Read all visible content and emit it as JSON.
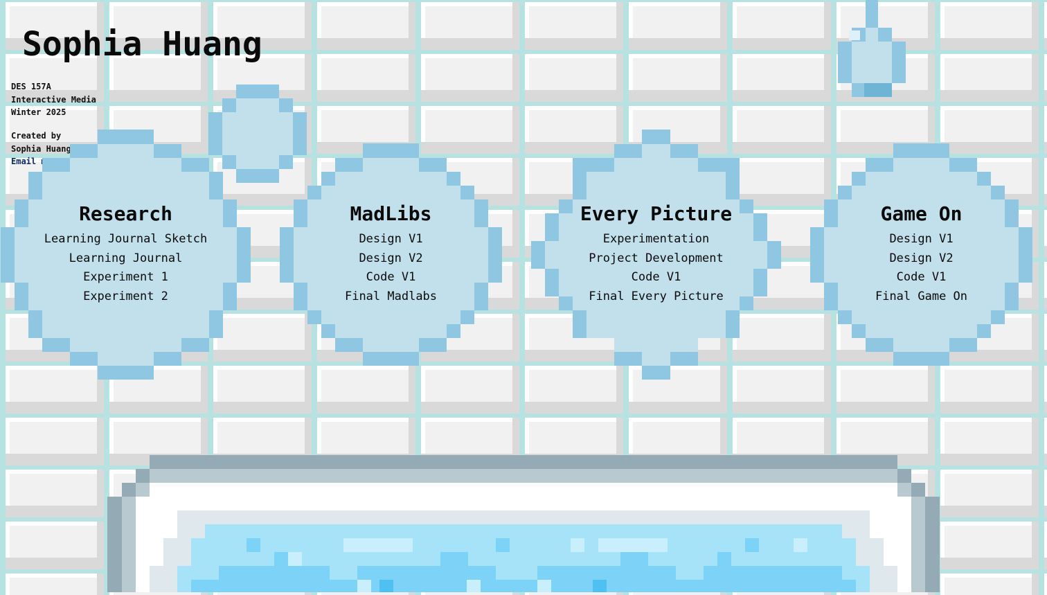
{
  "header": {
    "name": "Sophia Huang",
    "course_code": "DES 157A",
    "course_name": "Interactive Media",
    "term": "Winter 2025",
    "created_by_label": "Created by",
    "created_by_name": "Sophia Huang",
    "email_label": "Email m"
  },
  "projects": [
    {
      "title": "Research",
      "links": [
        "Learning Journal Sketch",
        "Learning Journal",
        "Experiment 1",
        "Experiment 2"
      ]
    },
    {
      "title": "MadLibs",
      "links": [
        "Design V1",
        "Design V2",
        "Code V1",
        "Final Madlabs"
      ]
    },
    {
      "title": "Every Picture",
      "links": [
        "Experimentation",
        "Project Development",
        "Code V1",
        "Final Every Picture"
      ]
    },
    {
      "title": "Game On",
      "links": [
        "Design V1",
        "Design V2",
        "Code V1",
        "Final Game On"
      ]
    }
  ],
  "colors": {
    "bubble_fill": "#c2e0ec",
    "bubble_edge": "#8fc6e2",
    "tile": "#f1f1f1",
    "grout": "#b7e2e2",
    "sink_rim": "#94aab5",
    "water": "#7dd3f7"
  },
  "icons": {
    "drop": "water-drop-icon",
    "bubble": "soap-bubble-icon"
  }
}
